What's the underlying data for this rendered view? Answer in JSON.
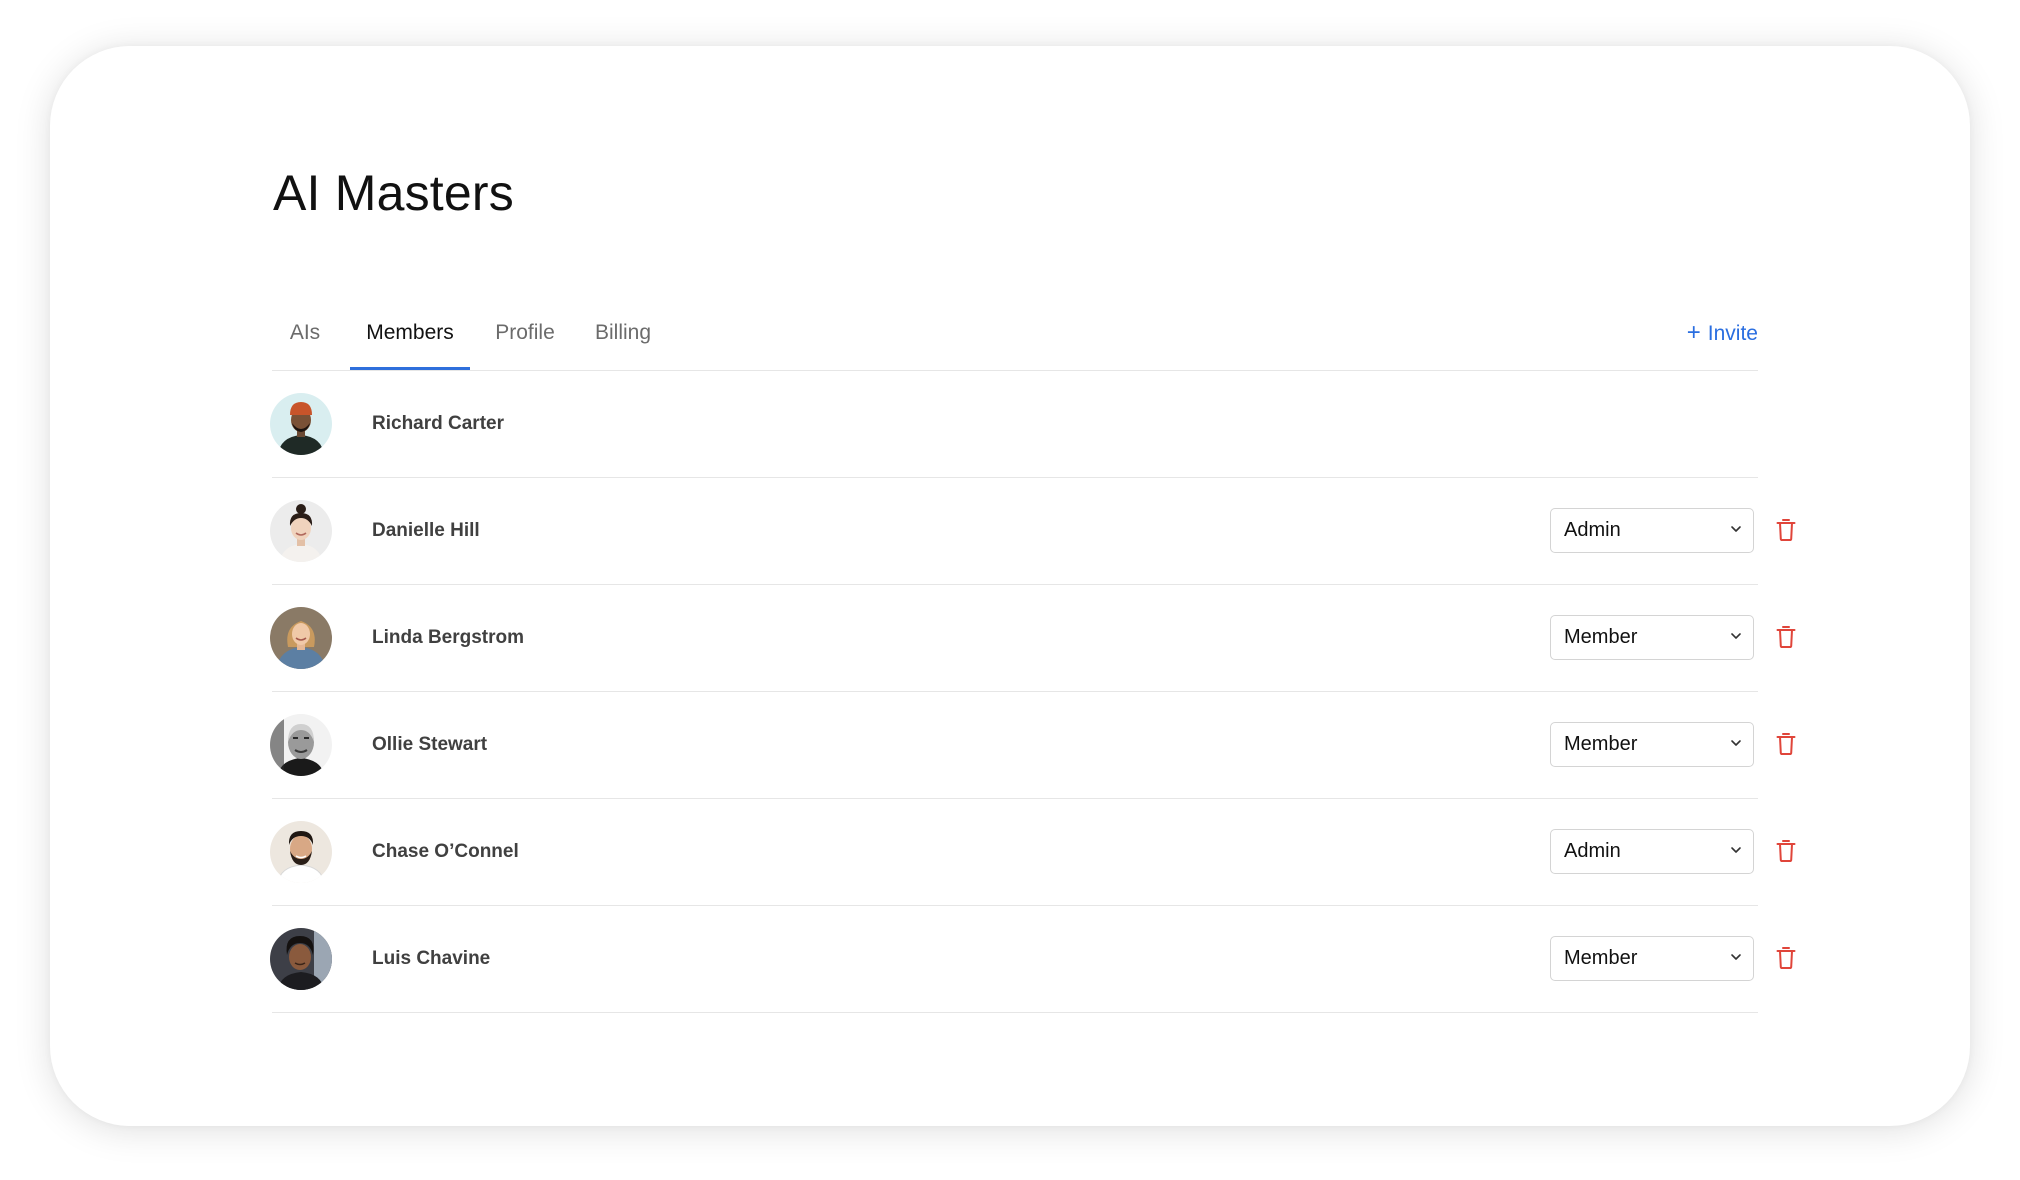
{
  "page": {
    "title": "AI Masters"
  },
  "tabs": [
    {
      "label": "AIs",
      "active": false
    },
    {
      "label": "Members",
      "active": true
    },
    {
      "label": "Profile",
      "active": false
    },
    {
      "label": "Billing",
      "active": false
    }
  ],
  "invite": {
    "icon": "plus-icon",
    "label": "Invite"
  },
  "colors": {
    "accent": "#2f6fdc",
    "delete": "#e0453a",
    "text": "#111111",
    "muted": "#6b6b6b",
    "divider": "#e6e6e6"
  },
  "members": [
    {
      "name": "Richard Carter",
      "role": null,
      "removable": false
    },
    {
      "name": "Danielle Hill",
      "role": "Admin",
      "removable": true
    },
    {
      "name": "Linda Bergstrom",
      "role": "Member",
      "removable": true
    },
    {
      "name": "Ollie Stewart",
      "role": "Member",
      "removable": true
    },
    {
      "name": "Chase O’Connel",
      "role": "Admin",
      "removable": true
    },
    {
      "name": "Luis Chavine",
      "role": "Member",
      "removable": true
    }
  ]
}
